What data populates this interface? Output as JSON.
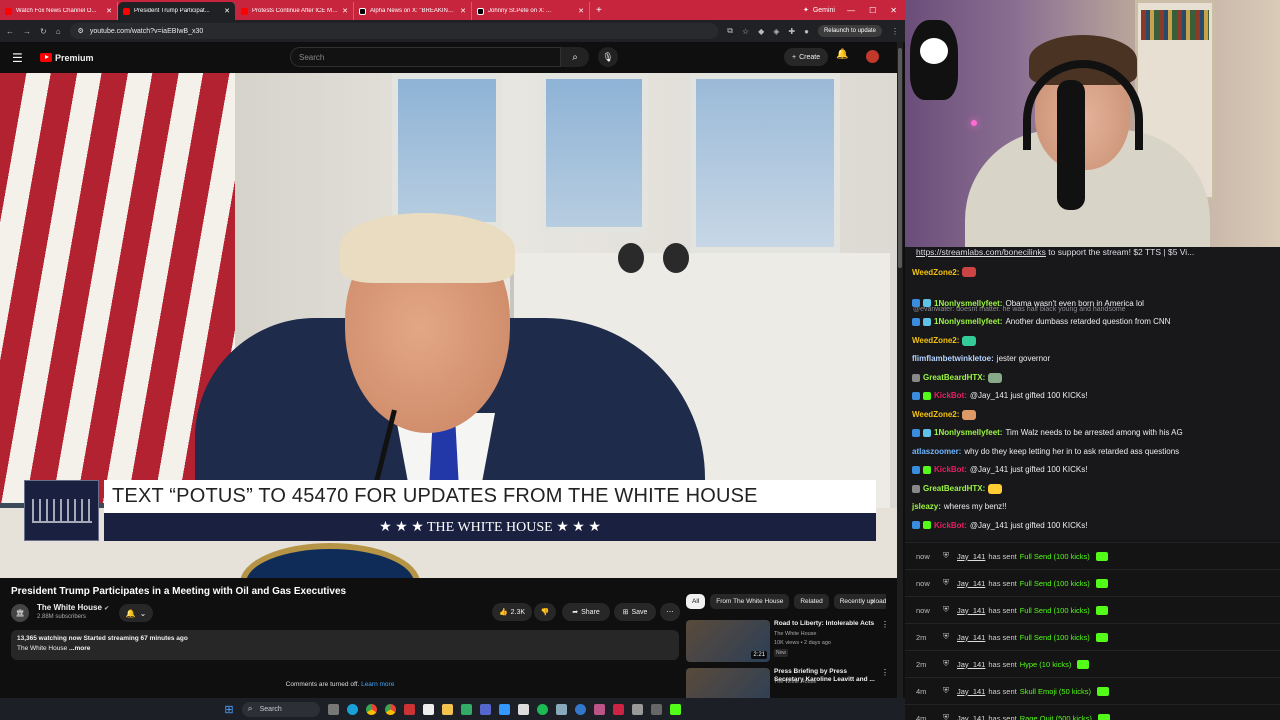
{
  "browser": {
    "tabs": [
      {
        "title": "Watch Fox News Channel O...",
        "icon": "youtube",
        "active": false
      },
      {
        "title": "President Trump Participat...",
        "icon": "youtube",
        "active": true
      },
      {
        "title": "Protests Continue After ICE Me...",
        "icon": "youtube",
        "active": false
      },
      {
        "title": "Alpha News on X: \"BREAKING...",
        "icon": "x",
        "active": false
      },
      {
        "title": "Johnny St.Pete on X: ...",
        "icon": "x",
        "active": false
      }
    ],
    "window_title": "Gemini",
    "url": "youtube.com/watch?v=iaEBIwB_x30",
    "relaunch_label": "Relaunch to update"
  },
  "youtube": {
    "logo_text": "Premium",
    "search_placeholder": "Search",
    "create_label": "Create",
    "video": {
      "lower_third_text": "TEXT “POTUS” TO 45470 FOR UPDATES FROM THE WHITE HOUSE",
      "lower_third_sub": "★ ★ ★  THE WHITE HOUSE  ★ ★ ★"
    },
    "title": "President Trump Participates in a Meeting with Oil and Gas Executives",
    "channel": {
      "name": "The White House",
      "subscribers": "2.88M subscribers"
    },
    "actions": {
      "likes": "2.3K",
      "share": "Share",
      "save": "Save"
    },
    "description": {
      "line1_bold": "13,365 watching now  Started streaming 67 minutes ago",
      "line2": "The White House",
      "more": "...more"
    },
    "comments_off": "Comments are turned off.",
    "learn_more": "Learn more",
    "chips": [
      "All",
      "From The White House",
      "Related",
      "Recently uploaded"
    ],
    "recommendations": [
      {
        "title": "Road to Liberty: Intolerable Acts",
        "channel": "The White House",
        "meta": "10K views • 2 days ago",
        "badge": "New",
        "duration": "2:21"
      },
      {
        "title": "Press Briefing by Press Secretary Karoline Leavitt and ...",
        "channel": "The White House",
        "meta": "",
        "badge": "",
        "duration": ""
      }
    ]
  },
  "taskbar": {
    "search_label": "Search"
  },
  "chat": {
    "pinned_link": "https://streamlabs.com/bonecilinks",
    "pinned_text": " to support the stream! $2 TTS | $5 Vi...",
    "messages": [
      {
        "type": "msg",
        "user": "WeedZone2:",
        "color": "#f4c20d",
        "text": "",
        "emote": "#c44"
      },
      {
        "type": "reply",
        "text": "@evanwater: doesnt matter. he was half black young and handsome"
      },
      {
        "type": "msg",
        "user": "1Nonlysmellyfeet:",
        "color": "#9cf542",
        "text": "Obama wasn't even born in America lol",
        "badges": true
      },
      {
        "type": "msg",
        "user": "1Nonlysmellyfeet:",
        "color": "#9cf542",
        "text": "Another dumbass retarded question from CNN",
        "badges": true
      },
      {
        "type": "msg",
        "user": "WeedZone2:",
        "color": "#f4c20d",
        "text": "",
        "emote": "#3c9"
      },
      {
        "type": "msg",
        "user": "flimflambetwinkletoe:",
        "color": "#b5d5ff",
        "text": "jester governor"
      },
      {
        "type": "msg",
        "user": "GreatBeardHTX:",
        "color": "#9cf542",
        "text": "",
        "emote": "#8a8",
        "badge1": true
      },
      {
        "type": "msg",
        "user": "KickBot:",
        "color": "#e91e63",
        "text": "@Jay_141 just gifted 100 KICKs!",
        "badges": true
      },
      {
        "type": "msg",
        "user": "WeedZone2:",
        "color": "#f4c20d",
        "text": "",
        "emote": "#d96"
      },
      {
        "type": "msg",
        "user": "1Nonlysmellyfeet:",
        "color": "#9cf542",
        "text": "Tim Walz needs to be arrested among with his AG",
        "badges": true
      },
      {
        "type": "msg",
        "user": "atlaszoomer:",
        "color": "#6fb6ff",
        "text": "why do they keep letting her in to ask retarded ass questions"
      },
      {
        "type": "msg",
        "user": "KickBot:",
        "color": "#e91e63",
        "text": "@Jay_141 just gifted 100 KICKs!",
        "badges": true
      },
      {
        "type": "msg",
        "user": "GreatBeardHTX:",
        "color": "#9cf542",
        "text": "",
        "emote": "#fc3",
        "badge1": true
      },
      {
        "type": "msg",
        "user": "jsleazy:",
        "color": "#9cf542",
        "text": "wheres my benz!!"
      },
      {
        "type": "msg",
        "user": "KickBot:",
        "color": "#e91e63",
        "text": "@Jay_141 just gifted 100 KICKs!",
        "badges": true
      }
    ]
  },
  "events": [
    {
      "time": "now",
      "user": "Jay_141",
      "action": "has sent",
      "item": "Full Send (100 kicks)"
    },
    {
      "time": "now",
      "user": "Jay_141",
      "action": "has sent",
      "item": "Full Send (100 kicks)"
    },
    {
      "time": "now",
      "user": "Jay_141",
      "action": "has sent",
      "item": "Full Send (100 kicks)"
    },
    {
      "time": "2m",
      "user": "Jay_141",
      "action": "has sent",
      "item": "Full Send (100 kicks)"
    },
    {
      "time": "2m",
      "user": "Jay_141",
      "action": "has sent",
      "item": "Hype (10 kicks)"
    },
    {
      "time": "4m",
      "user": "Jay_141",
      "action": "has sent",
      "item": "Skull Emoji (50 kicks)"
    },
    {
      "time": "4m",
      "user": "Jay_141",
      "action": "has sent",
      "item": "Rage Quit (500 kicks)"
    }
  ]
}
